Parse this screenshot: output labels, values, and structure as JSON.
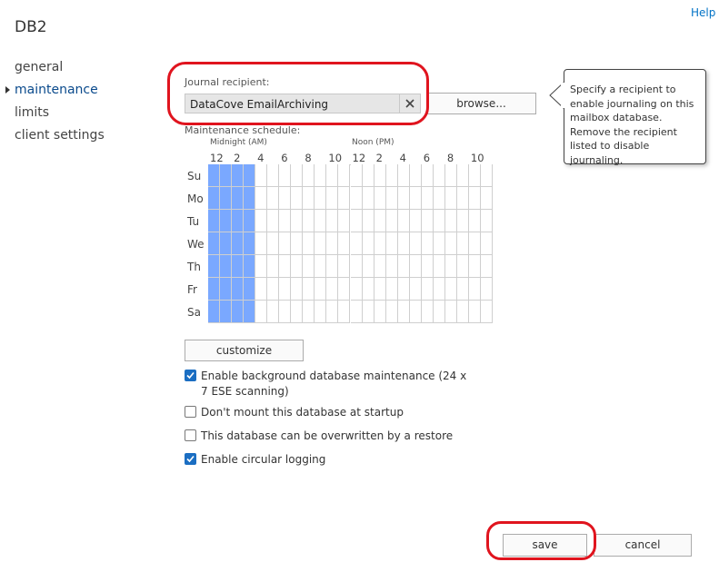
{
  "header": {
    "title": "DB2",
    "help_label": "Help"
  },
  "sidebar": {
    "items": [
      {
        "label": "general",
        "active": false
      },
      {
        "label": "maintenance",
        "active": true
      },
      {
        "label": "limits",
        "active": false
      },
      {
        "label": "client settings",
        "active": false
      }
    ]
  },
  "journal": {
    "label": "Journal recipient:",
    "value": "DataCove EmailArchiving",
    "browse_label": "browse...",
    "callout_text": "Specify a recipient to enable journaling on this mailbox database. Remove the recipient listed to disable journaling."
  },
  "schedule": {
    "label": "Maintenance schedule:",
    "am_label": "Midnight (AM)",
    "pm_label": "Noon (PM)",
    "hour_labels": [
      "12",
      "2",
      "4",
      "6",
      "8",
      "10",
      "12",
      "2",
      "4",
      "6",
      "8",
      "10"
    ],
    "days": [
      "Su",
      "Mo",
      "Tu",
      "We",
      "Th",
      "Fr",
      "Sa"
    ],
    "selected_hours": [
      0,
      1,
      2,
      3
    ],
    "selected_color": "#7aa8ff",
    "customize_label": "customize"
  },
  "options": [
    {
      "label": "Enable background database maintenance (24 x 7 ESE scanning)",
      "checked": true
    },
    {
      "label": "Don't mount this database at startup",
      "checked": false
    },
    {
      "label": "This database can be overwritten by a restore",
      "checked": false
    },
    {
      "label": "Enable circular logging",
      "checked": true
    }
  ],
  "footer": {
    "save_label": "save",
    "cancel_label": "cancel"
  },
  "colors": {
    "accent": "#0072c6",
    "highlight_ring": "#e0141e",
    "checkbox_checked": "#1b6ec2"
  }
}
